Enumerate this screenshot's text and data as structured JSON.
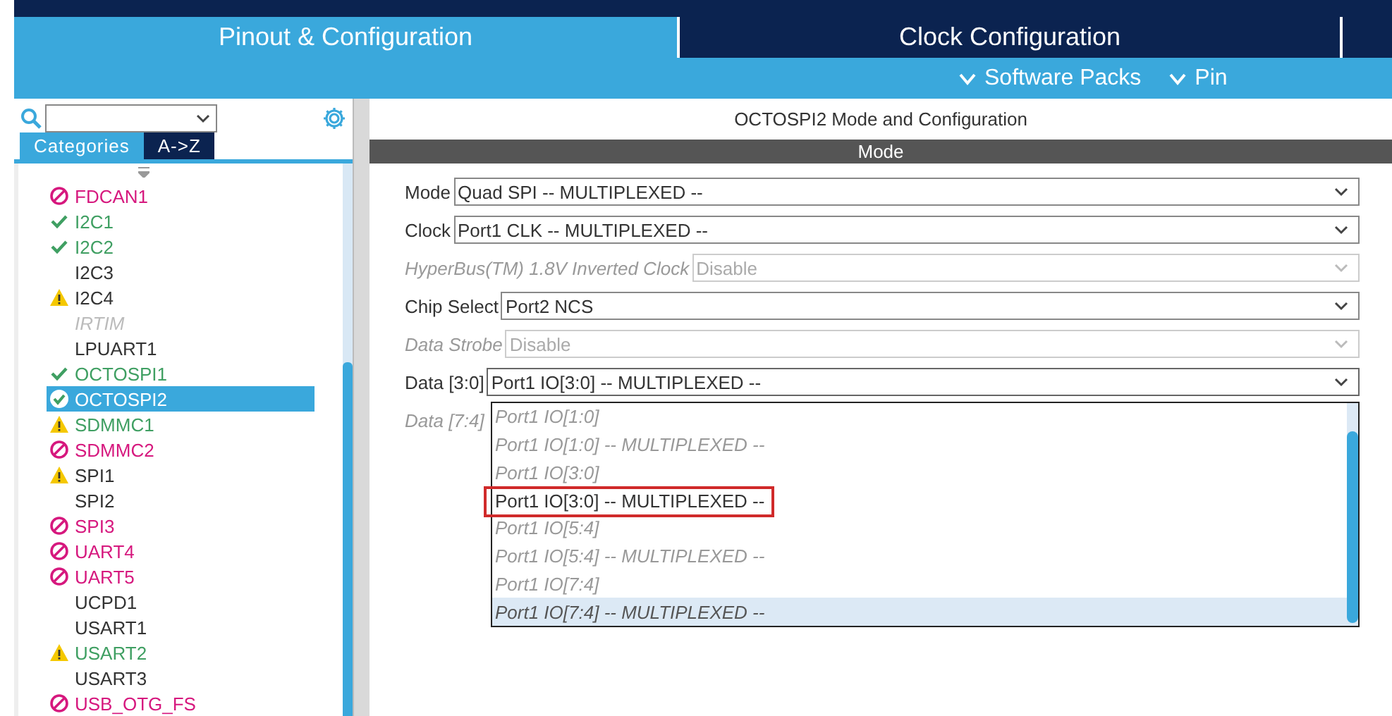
{
  "top_tabs": [
    {
      "label": "Pinout & Configuration",
      "selected": true
    },
    {
      "label": "Clock Configuration",
      "selected": false
    },
    {
      "selected": false
    }
  ],
  "sub_menu": [
    "Software Packs",
    "Pin"
  ],
  "sidebar": {
    "view_tabs": [
      {
        "label": "Categories",
        "selected": true
      },
      {
        "label": "A->Z",
        "selected": false
      }
    ],
    "items": [
      {
        "label": "FDCAN1",
        "kind": "error",
        "configured": false,
        "unavailable": false,
        "selected": false
      },
      {
        "label": "I2C1",
        "kind": "ok",
        "configured": true,
        "unavailable": false,
        "selected": false
      },
      {
        "label": "I2C2",
        "kind": "ok",
        "configured": true,
        "unavailable": false,
        "selected": false
      },
      {
        "label": "I2C3",
        "kind": "none",
        "configured": false,
        "unavailable": false,
        "selected": false
      },
      {
        "label": "I2C4",
        "kind": "warning",
        "configured": false,
        "unavailable": false,
        "selected": false
      },
      {
        "label": "IRTIM",
        "kind": "none",
        "configured": false,
        "unavailable": true,
        "selected": false
      },
      {
        "label": "LPUART1",
        "kind": "none",
        "configured": false,
        "unavailable": false,
        "selected": false
      },
      {
        "label": "OCTOSPI1",
        "kind": "ok",
        "configured": true,
        "unavailable": false,
        "selected": false
      },
      {
        "label": "OCTOSPI2",
        "kind": "ok",
        "configured": true,
        "unavailable": false,
        "selected": true
      },
      {
        "label": "SDMMC1",
        "kind": "warning",
        "configured": true,
        "unavailable": false,
        "selected": false
      },
      {
        "label": "SDMMC2",
        "kind": "error",
        "configured": false,
        "unavailable": false,
        "selected": false
      },
      {
        "label": "SPI1",
        "kind": "warning",
        "configured": false,
        "unavailable": false,
        "selected": false
      },
      {
        "label": "SPI2",
        "kind": "none",
        "configured": false,
        "unavailable": false,
        "selected": false
      },
      {
        "label": "SPI3",
        "kind": "error",
        "configured": false,
        "unavailable": false,
        "selected": false
      },
      {
        "label": "UART4",
        "kind": "error",
        "configured": false,
        "unavailable": false,
        "selected": false
      },
      {
        "label": "UART5",
        "kind": "error",
        "configured": false,
        "unavailable": false,
        "selected": false
      },
      {
        "label": "UCPD1",
        "kind": "none",
        "configured": false,
        "unavailable": false,
        "selected": false
      },
      {
        "label": "USART1",
        "kind": "none",
        "configured": false,
        "unavailable": false,
        "selected": false
      },
      {
        "label": "USART2",
        "kind": "warning",
        "configured": true,
        "unavailable": false,
        "selected": false
      },
      {
        "label": "USART3",
        "kind": "none",
        "configured": false,
        "unavailable": false,
        "selected": false
      },
      {
        "label": "USB_OTG_FS",
        "kind": "error",
        "configured": false,
        "unavailable": false,
        "selected": false
      }
    ]
  },
  "panel": {
    "title": "OCTOSPI2 Mode and Configuration",
    "section": "Mode",
    "fields": [
      {
        "label": "Mode",
        "value": "Quad SPI -- MULTIPLEXED --",
        "disabled": false
      },
      {
        "label": "Clock",
        "value": "Port1 CLK -- MULTIPLEXED --",
        "disabled": false
      },
      {
        "label": "HyperBus(TM) 1.8V Inverted Clock",
        "value": "Disable",
        "disabled": true
      },
      {
        "label": "Chip Select",
        "value": "Port2 NCS",
        "disabled": false
      },
      {
        "label": "Data Strobe",
        "value": "Disable",
        "disabled": true
      },
      {
        "label": "Data [3:0]",
        "value": "Port1 IO[3:0] -- MULTIPLEXED --",
        "disabled": false,
        "expanded": true
      },
      {
        "label": "Data [7:4]",
        "disabled": true
      }
    ],
    "dropdown_options": [
      {
        "label": "Port1 IO[1:0]",
        "available": false,
        "selected": false,
        "outlined": false
      },
      {
        "label": "Port1 IO[1:0] -- MULTIPLEXED --",
        "available": false,
        "selected": false,
        "outlined": false
      },
      {
        "label": "Port1 IO[3:0]",
        "available": false,
        "selected": false,
        "outlined": false
      },
      {
        "label": "Port1 IO[3:0] -- MULTIPLEXED --",
        "available": true,
        "selected": false,
        "outlined": true
      },
      {
        "label": "Port1 IO[5:4]",
        "available": false,
        "selected": false,
        "outlined": false
      },
      {
        "label": "Port1 IO[5:4] -- MULTIPLEXED --",
        "available": false,
        "selected": false,
        "outlined": false
      },
      {
        "label": "Port1 IO[7:4]",
        "available": false,
        "selected": false,
        "outlined": false
      },
      {
        "label": "Port1 IO[7:4] -- MULTIPLEXED --",
        "available": false,
        "selected": true,
        "outlined": false
      }
    ]
  }
}
